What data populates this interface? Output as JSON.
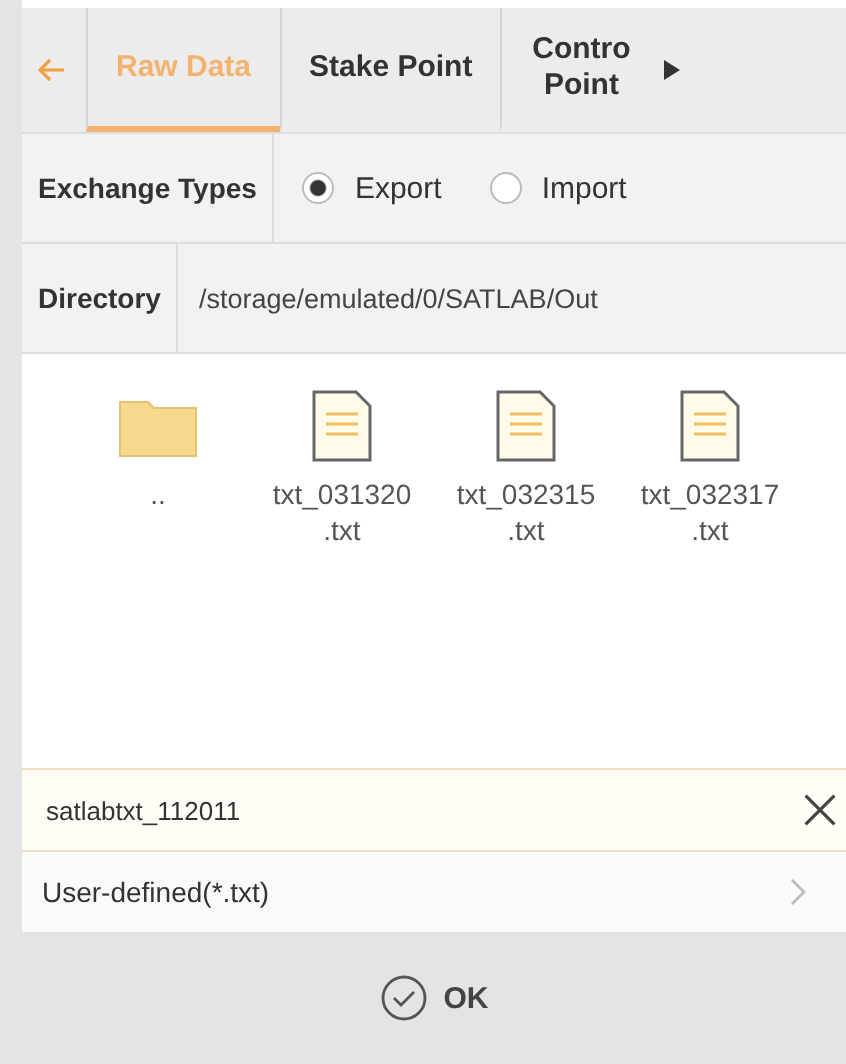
{
  "tabs": [
    {
      "label": "Raw Data",
      "selected": true
    },
    {
      "label": "Stake Point",
      "selected": false
    },
    {
      "label": "Contro Point",
      "selected": false
    }
  ],
  "exchange": {
    "label": "Exchange Types",
    "options": [
      {
        "label": "Export",
        "selected": true
      },
      {
        "label": "Import",
        "selected": false
      }
    ]
  },
  "directory": {
    "label": "Directory",
    "path": "/storage/emulated/0/SATLAB/Out"
  },
  "files": [
    {
      "kind": "folder",
      "name": ".."
    },
    {
      "kind": "file",
      "name": "txt_031320 .txt"
    },
    {
      "kind": "file",
      "name": "txt_032315 .txt"
    },
    {
      "kind": "file",
      "name": "txt_032317 .txt"
    }
  ],
  "filename": {
    "value": "satlabtxt_112011"
  },
  "format": {
    "label": "User-defined(*.txt)"
  },
  "ok_button": {
    "label": "OK"
  }
}
